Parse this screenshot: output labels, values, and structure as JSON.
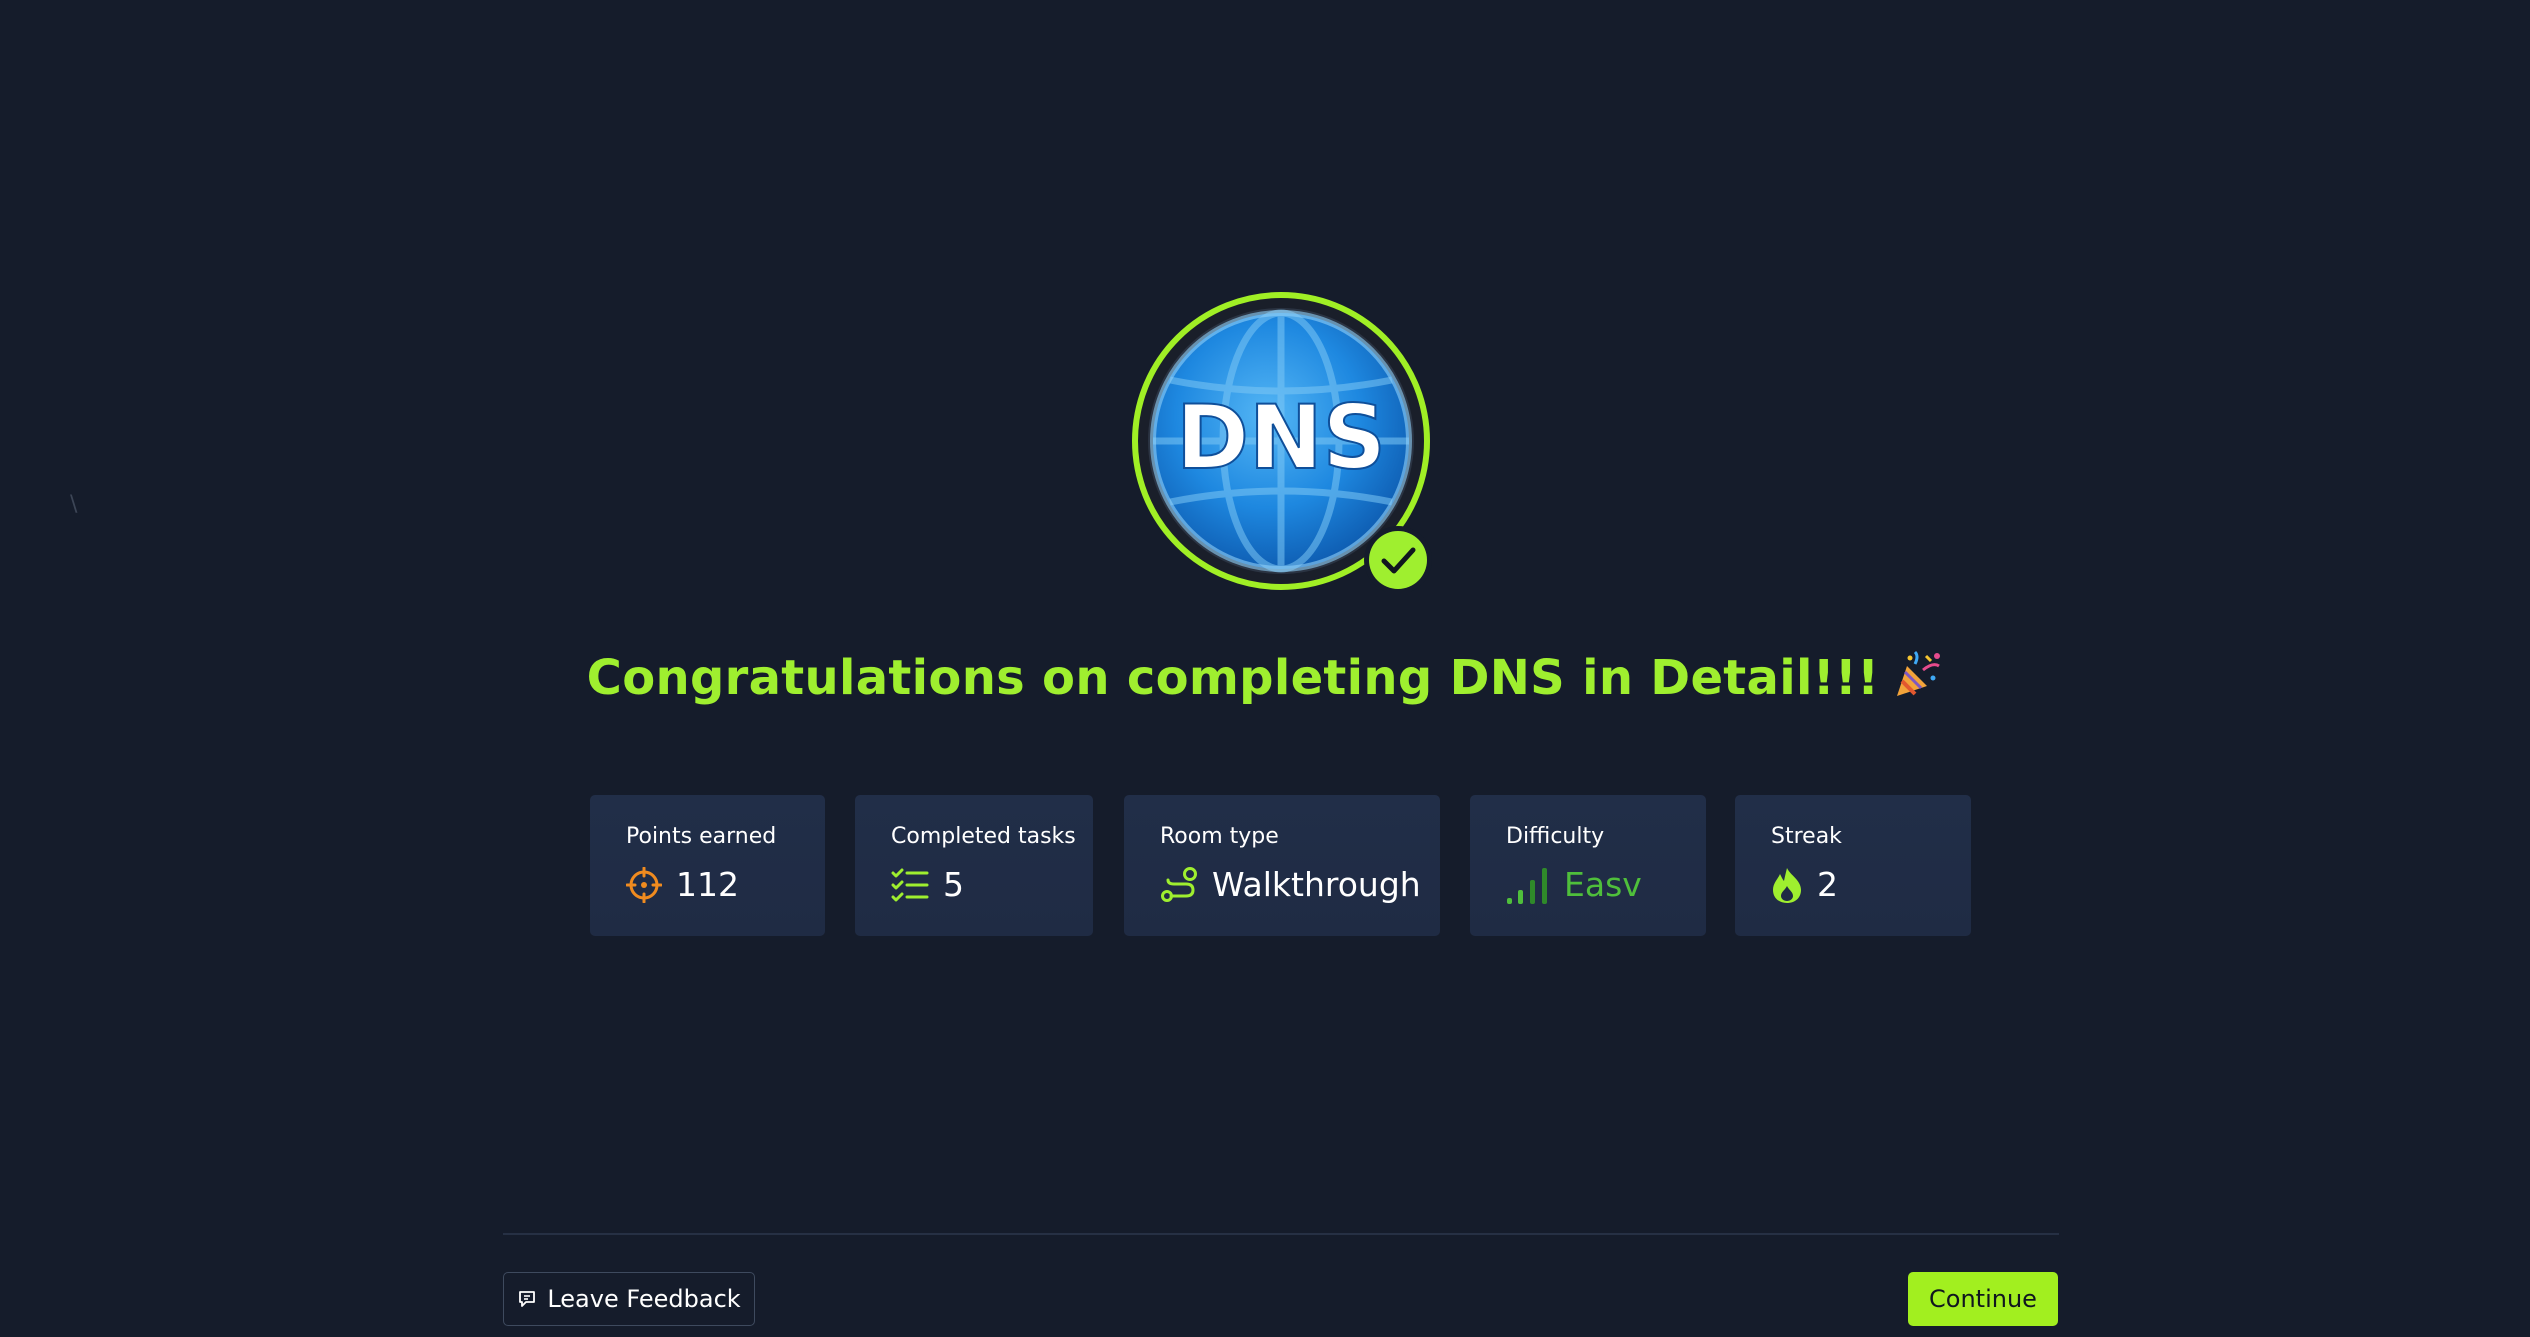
{
  "badge": {
    "text": "DNS",
    "icon": "dns-globe-icon",
    "completed_icon": "checkmark-icon"
  },
  "title": {
    "text": "Congratulations on completing DNS in Detail!!!",
    "emoji_icon": "party-popper-icon"
  },
  "stats": [
    {
      "label": "Points earned",
      "value": "112",
      "icon": "crosshair-target-icon",
      "icon_color": "#f08b1f"
    },
    {
      "label": "Completed tasks",
      "value": "5",
      "icon": "checklist-icon",
      "icon_color": "#9fef2f"
    },
    {
      "label": "Room type",
      "value": "Walkthrough",
      "icon": "route-icon",
      "icon_color": "#9fef2f"
    },
    {
      "label": "Difficulty",
      "value": "Easv",
      "icon": "signal-bars-icon",
      "icon_color": "#4fbf3b"
    },
    {
      "label": "Streak",
      "value": "2",
      "icon": "flame-icon",
      "icon_color": "#9fef2f"
    }
  ],
  "footer": {
    "feedback_label": "Leave Feedback",
    "feedback_icon": "chat-bubble-icon",
    "continue_label": "Continue"
  },
  "colors": {
    "background": "#151c2b",
    "card": "#212e48",
    "accent": "#9fef2f",
    "easy_green": "#4fbf3b"
  },
  "stray_glyph": "\\"
}
